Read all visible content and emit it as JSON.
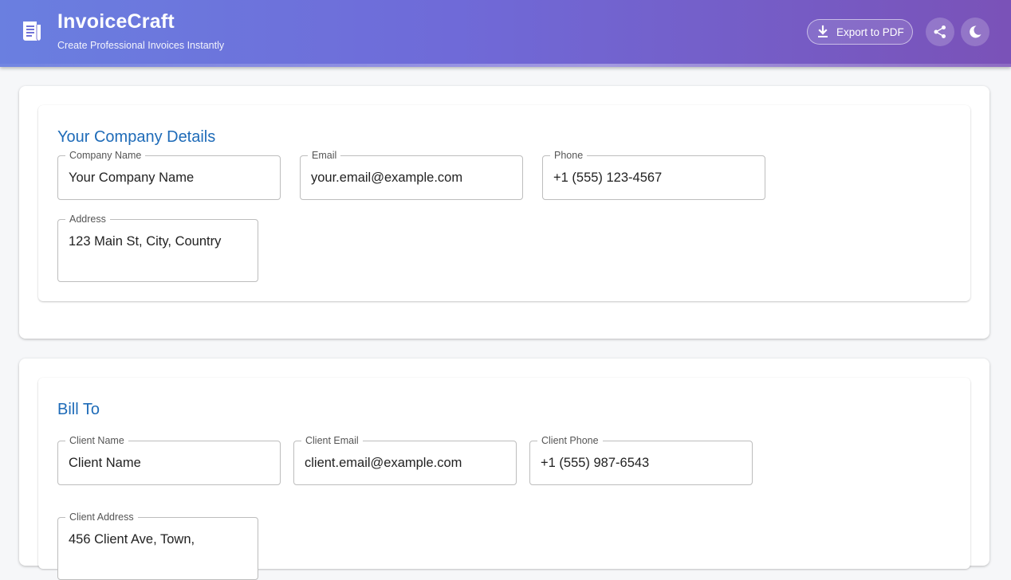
{
  "header": {
    "title": "InvoiceCraft",
    "subtitle": "Create Professional Invoices Instantly",
    "export_label": "Export to PDF",
    "logo_icon": "receipt-icon",
    "export_icon": "download-icon",
    "share_icon": "share-icon",
    "theme_icon": "moon-icon"
  },
  "company": {
    "heading": "Your Company Details",
    "fields": {
      "name": {
        "label": "Company Name",
        "value": "Your Company Name"
      },
      "email": {
        "label": "Email",
        "value": "your.email@example.com"
      },
      "phone": {
        "label": "Phone",
        "value": "+1 (555) 123-4567"
      },
      "address": {
        "label": "Address",
        "value": "123 Main St, City, Country"
      }
    }
  },
  "client": {
    "heading": "Bill To",
    "fields": {
      "name": {
        "label": "Client Name",
        "value": "Client Name"
      },
      "email": {
        "label": "Client Email",
        "value": "client.email@example.com"
      },
      "phone": {
        "label": "Client Phone",
        "value": "+1 (555) 987-6543"
      },
      "address": {
        "label": "Client Address",
        "value": "456 Client Ave, Town,"
      }
    }
  },
  "colors": {
    "accent": "#1e6bb8",
    "header_gradient_start": "#6a7fe0",
    "header_gradient_end": "#7a52b8"
  }
}
